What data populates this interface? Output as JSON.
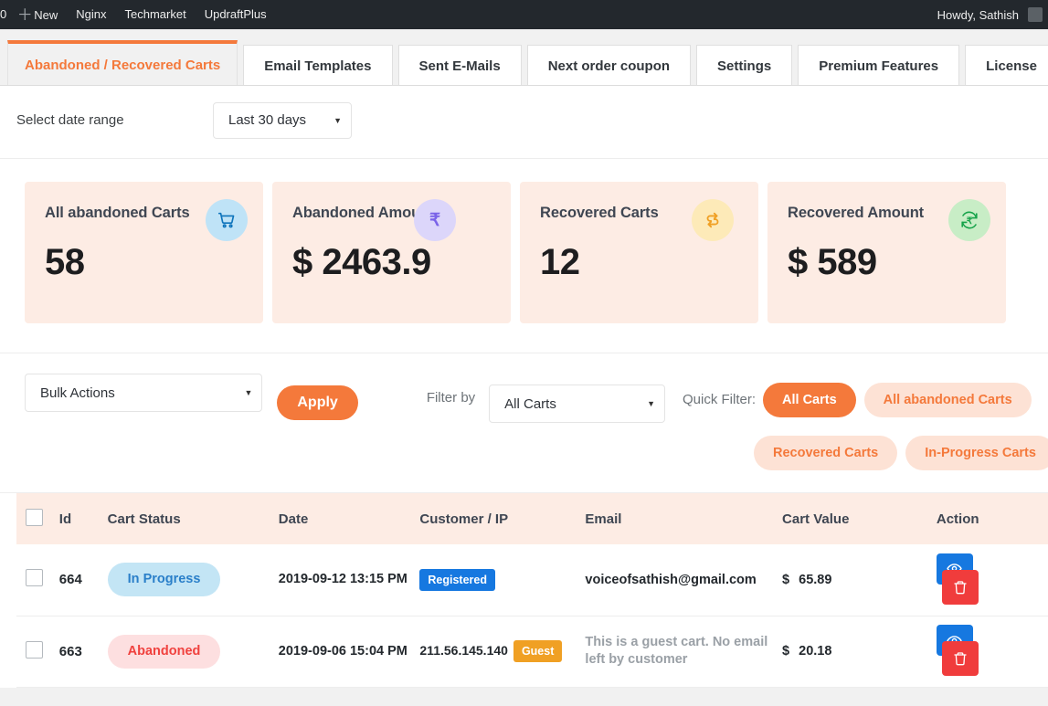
{
  "adminbar": {
    "site_initial": "0",
    "new_label": "New",
    "items": [
      "Nginx",
      "Techmarket",
      "UpdraftPlus"
    ],
    "howdy": "Howdy, Sathish"
  },
  "tabs": [
    {
      "label": "Abandoned / Recovered Carts",
      "active": true
    },
    {
      "label": "Email Templates",
      "active": false
    },
    {
      "label": "Sent E-Mails",
      "active": false
    },
    {
      "label": "Next order coupon",
      "active": false
    },
    {
      "label": "Settings",
      "active": false
    },
    {
      "label": "Premium Features",
      "active": false
    },
    {
      "label": "License",
      "active": false
    }
  ],
  "daterange": {
    "label": "Select date range",
    "value": "Last 30 days"
  },
  "cards": [
    {
      "title": "All abandoned Carts",
      "value": "58",
      "icon": "shopping-cart-icon",
      "bg": "#bfe3f7",
      "fg": "#0e74bc"
    },
    {
      "title": "Abandoned Amount",
      "value": "$ 2463.9",
      "icon": "rupee-icon",
      "bg": "#dcd6fa",
      "fg": "#7a63e8"
    },
    {
      "title": "Recovered Carts",
      "value": "12",
      "icon": "refresh-cycle-icon",
      "bg": "#fdeab8",
      "fg": "#f0a024"
    },
    {
      "title": "Recovered Amount",
      "value": "$ 589",
      "icon": "rupee-refresh-icon",
      "bg": "#c8edc6",
      "fg": "#16a34a"
    }
  ],
  "filterbar": {
    "bulk_actions_value": "Bulk Actions",
    "apply_label": "Apply",
    "filter_by_label": "Filter by",
    "filter_by_value": "All Carts",
    "quick_filter_label": "Quick Filter:",
    "quick_filters": [
      {
        "label": "All Carts",
        "active": true
      },
      {
        "label": "All abandoned Carts",
        "active": false
      },
      {
        "label": "Recovered Carts",
        "active": false
      },
      {
        "label": "In-Progress Carts",
        "active": false
      }
    ]
  },
  "table": {
    "columns": [
      "Id",
      "Cart Status",
      "Date",
      "Customer / IP",
      "Email",
      "Cart Value",
      "Action"
    ],
    "rows": [
      {
        "id": "664",
        "status": "In Progress",
        "status_kind": "inprogress",
        "date": "2019-09-12 13:15 PM",
        "ip": "",
        "customer_tag": "Registered",
        "customer_tag_kind": "registered",
        "email": "voiceofsathish@gmail.com",
        "email_muted": false,
        "currency": "$",
        "value": "65.89"
      },
      {
        "id": "663",
        "status": "Abandoned",
        "status_kind": "abandoned",
        "date": "2019-09-06 15:04 PM",
        "ip": "211.56.145.140",
        "customer_tag": "Guest",
        "customer_tag_kind": "guest",
        "email": "This is a guest cart. No email left by customer",
        "email_muted": true,
        "currency": "$",
        "value": "20.18"
      }
    ]
  }
}
